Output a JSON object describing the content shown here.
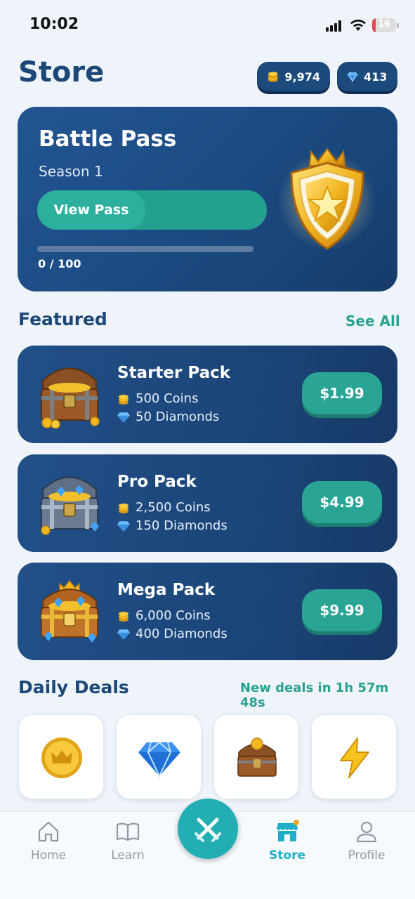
{
  "status_bar": {
    "time": "10:02",
    "battery": "16",
    "battery_level": 0.16
  },
  "header": {
    "title": "Store",
    "coins": "9,974",
    "diamonds": "413"
  },
  "battle_pass": {
    "title": "Battle Pass",
    "season": "Season 1",
    "button_label": "View Pass",
    "progress_text": "0 / 100",
    "progress": 0
  },
  "featured": {
    "title": "Featured",
    "see_all": "See All",
    "packs": [
      {
        "name": "Starter Pack",
        "coins": "500 Coins",
        "diamonds": "50 Diamonds",
        "price": "$1.99"
      },
      {
        "name": "Pro Pack",
        "coins": "2,500 Coins",
        "diamonds": "150 Diamonds",
        "price": "$4.99"
      },
      {
        "name": "Mega Pack",
        "coins": "6,000 Coins",
        "diamonds": "400 Diamonds",
        "price": "$9.99"
      }
    ]
  },
  "daily_deals": {
    "title": "Daily Deals",
    "timer": "New deals in 1h 57m 48s",
    "items": [
      {
        "icon": "coin-icon",
        "label": ""
      },
      {
        "icon": "diamond-icon",
        "label": ""
      },
      {
        "icon": "chest-icon",
        "label": ""
      },
      {
        "icon": "lightning-icon",
        "label": ""
      }
    ]
  },
  "nav": {
    "home": "Home",
    "learn": "Learn",
    "store": "Store",
    "profile": "Profile"
  },
  "colors": {
    "brand_navy": "#1c4877",
    "accent_teal": "#2aa595",
    "active_nav": "#1eaec9"
  }
}
